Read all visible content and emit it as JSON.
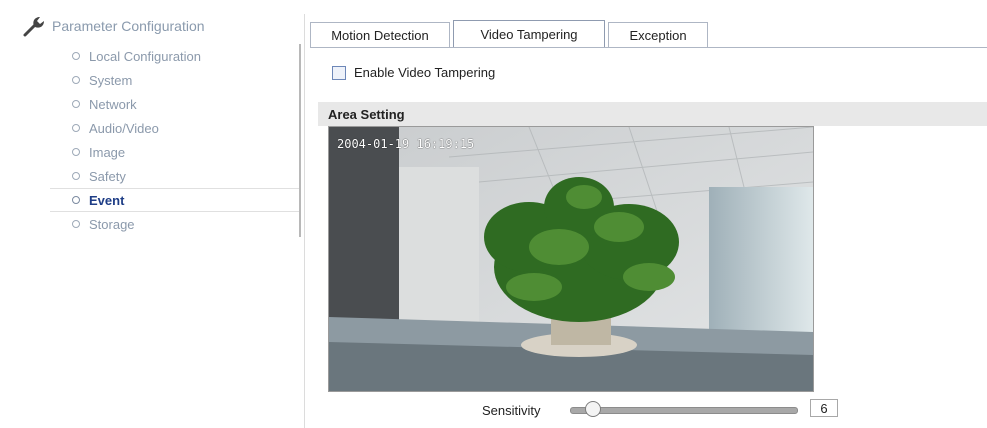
{
  "sidebar": {
    "title": "Parameter Configuration",
    "icon": "wrench-icon",
    "items": [
      {
        "label": "Local Configuration",
        "active": false
      },
      {
        "label": "System",
        "active": false
      },
      {
        "label": "Network",
        "active": false
      },
      {
        "label": "Audio/Video",
        "active": false
      },
      {
        "label": "Image",
        "active": false
      },
      {
        "label": "Safety",
        "active": false
      },
      {
        "label": "Event",
        "active": true
      },
      {
        "label": "Storage",
        "active": false
      }
    ]
  },
  "tabs": [
    {
      "label": "Motion Detection",
      "active": false
    },
    {
      "label": "Video Tampering",
      "active": true
    },
    {
      "label": "Exception",
      "active": false
    }
  ],
  "enable": {
    "label": "Enable Video Tampering",
    "checked": false
  },
  "area": {
    "title": "Area Setting",
    "timestamp": "2004-01-19 16:19:15"
  },
  "sensitivity": {
    "label": "Sensitivity",
    "value": "6",
    "level": 0.1
  },
  "colors": {
    "active_text": "#1e3d86",
    "menu_text": "#8b99ab",
    "header_bar": "#e8e8e8"
  }
}
